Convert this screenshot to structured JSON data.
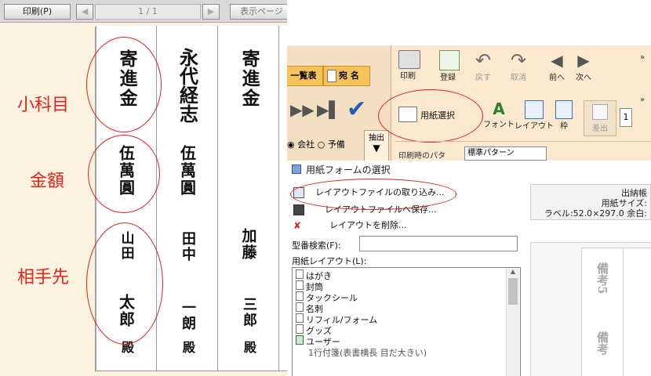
{
  "left_toolbar": {
    "print_button": "印刷(P)",
    "page_indicator": "1 / 1",
    "view_button": "表示ページ"
  },
  "annotations": {
    "sub_item": "小科目",
    "amount": "金額",
    "counterpart": "相手先"
  },
  "columns": [
    {
      "top": "寄進金",
      "middle": "伍萬圓",
      "name1": "山田",
      "name2": "太郎",
      "suffix": "殿"
    },
    {
      "top": "永代経志",
      "middle": "伍萬圓",
      "name1": "田中",
      "name2": "一朗",
      "suffix": "殿"
    },
    {
      "top": "寄進金",
      "middle": "",
      "name1": "加藤",
      "name2": "三郎",
      "suffix": "殿"
    }
  ],
  "ribbon": {
    "tab_list": "一覧表",
    "tab_address": "宛 名",
    "radio_company": "会社",
    "radio_spare": "予備",
    "extract": "抽出",
    "print_pattern_label": "印刷時のパタ",
    "print_pattern_value": "標準パターン",
    "print": "印刷",
    "register": "登録",
    "back": "戻す",
    "cancel": "取消",
    "prev": "前へ",
    "next": "次へ",
    "paper_select": "用紙選択",
    "font": "フォント",
    "layout": "レイアウト",
    "frame": "枠",
    "insert": "差出",
    "page_value": "1"
  },
  "dialog": {
    "title": "用紙フォームの選択",
    "import_layout": "レイアウトファイルの取り込み...",
    "save_layout": "レイアウトファイルへ保存...",
    "delete_layout": "レイアウトを削除...",
    "model_search_label": "型番検索(F):",
    "model_search_value": "",
    "paper_layout_label": "用紙レイアウト(L):",
    "layout_items": [
      "はがき",
      "封筒",
      "タックシール",
      "名刺",
      "リフィル/フォーム",
      "グッズ",
      "ユーザー",
      "1行付箋(表書横長 目だ大きい)"
    ],
    "info_line1": "出納帳",
    "info_line2": "用紙サイズ:",
    "info_line3": "ラベル:52.0×297.0 余白:",
    "preview_text1": "備考5",
    "preview_text2": "備考"
  },
  "colors": {
    "annotation_red": "#e4231b",
    "ribbon_bg": "#fbe9cf",
    "preview_bg": "#fbf2e0",
    "check_blue": "#1f5fbf"
  }
}
